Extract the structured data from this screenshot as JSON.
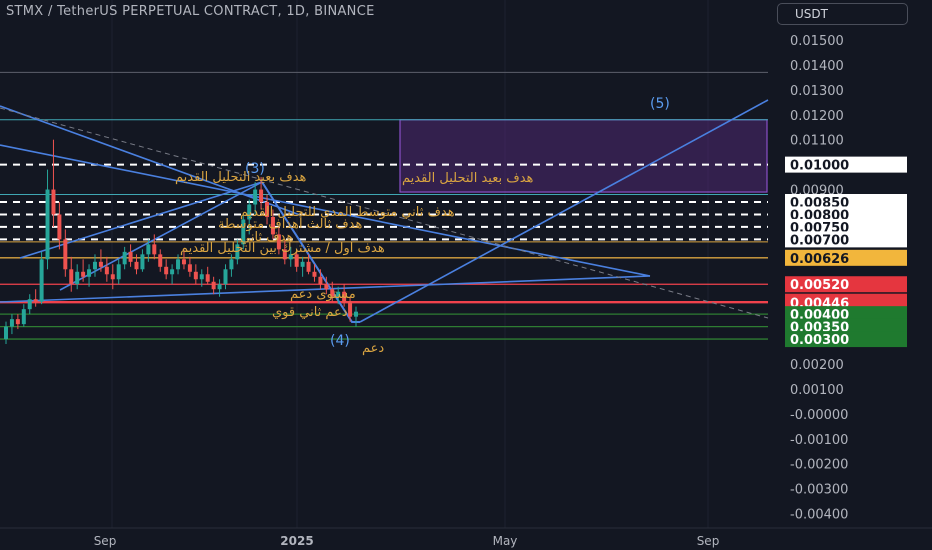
{
  "header": {
    "title": "STMX / TetherUS PERPETUAL CONTRACT, 1D, BINANCE",
    "currency": "USDT"
  },
  "colors": {
    "background": "#131722",
    "up": "#26a69a",
    "down": "#ef5350",
    "trendline": "#4a80e0",
    "annotation": "#d9a441",
    "zone": "#5b2d82"
  },
  "chart_data": {
    "type": "candlestick",
    "title": "STMX / TetherUS PERPETUAL CONTRACT, 1D, BINANCE",
    "y_axis_ticks": [
      "0.01500",
      "0.01400",
      "0.01300",
      "0.01200",
      "0.01100",
      "0.01000",
      "0.00900",
      "0.00200",
      "0.00100",
      "-0.00000",
      "-0.00100",
      "-0.00200",
      "-0.00300",
      "-0.00400"
    ],
    "ylim": [
      -0.0045,
      0.0158
    ],
    "x_axis_ticks": [
      "Sep",
      "2025",
      "May",
      "Sep"
    ],
    "price_tags": [
      {
        "value": "0.01000",
        "style": "white"
      },
      {
        "value": "0.00850",
        "style": "white"
      },
      {
        "value": "0.00800",
        "style": "white"
      },
      {
        "value": "0.00750",
        "style": "white"
      },
      {
        "value": "0.00700",
        "style": "white"
      },
      {
        "value": "0.00626",
        "style": "yellow"
      },
      {
        "value": "0.00520",
        "style": "red"
      },
      {
        "value": "0.00450",
        "style": "red"
      },
      {
        "value": "0.00446",
        "style": "red"
      },
      {
        "value": "0.00400",
        "style": "green"
      },
      {
        "value": "0.00350",
        "style": "green"
      },
      {
        "value": "0.00300",
        "style": "green"
      }
    ],
    "wave_labels": [
      "(3)",
      "(4)",
      "(5)"
    ],
    "annotations": [
      {
        "text": "هدف بعيد التحليل القديم"
      },
      {
        "text": "هدف ثاني متوسط المدى للتحليل القديم"
      },
      {
        "text": "هدف ثالث أهداف متوسطة"
      },
      {
        "text": "هدف ثاني"
      },
      {
        "text": "هدف اول / مشترك بين التحليل القديم"
      },
      {
        "text": "مستوى دعم"
      },
      {
        "text": "دعم ثاني قوي"
      },
      {
        "text": "دعم"
      }
    ],
    "target_zone": {
      "from": 0.0089,
      "to": 0.0118,
      "label": "هدف بعيد التحليل القديم"
    },
    "candles": [
      [
        0.003,
        0.0037,
        0.0028,
        0.0035
      ],
      [
        0.0035,
        0.004,
        0.0032,
        0.0038
      ],
      [
        0.0038,
        0.004,
        0.0034,
        0.0036
      ],
      [
        0.0036,
        0.0044,
        0.0035,
        0.0042
      ],
      [
        0.0042,
        0.0048,
        0.004,
        0.0046
      ],
      [
        0.0046,
        0.005,
        0.0043,
        0.0045
      ],
      [
        0.0045,
        0.0065,
        0.0044,
        0.0062
      ],
      [
        0.0062,
        0.0098,
        0.0058,
        0.009
      ],
      [
        0.009,
        0.011,
        0.0075,
        0.008
      ],
      [
        0.008,
        0.0085,
        0.0066,
        0.007
      ],
      [
        0.007,
        0.0074,
        0.0055,
        0.0058
      ],
      [
        0.0058,
        0.0063,
        0.0049,
        0.0052
      ],
      [
        0.0052,
        0.006,
        0.005,
        0.0057
      ],
      [
        0.0057,
        0.0062,
        0.0053,
        0.0055
      ],
      [
        0.0055,
        0.006,
        0.0051,
        0.0058
      ],
      [
        0.0058,
        0.0064,
        0.0055,
        0.0061
      ],
      [
        0.0061,
        0.0066,
        0.0057,
        0.0059
      ],
      [
        0.0059,
        0.0063,
        0.0053,
        0.0056
      ],
      [
        0.0056,
        0.006,
        0.005,
        0.0054
      ],
      [
        0.0054,
        0.0062,
        0.0052,
        0.006
      ],
      [
        0.006,
        0.0067,
        0.0058,
        0.0065
      ],
      [
        0.0065,
        0.0068,
        0.0059,
        0.0061
      ],
      [
        0.0061,
        0.0064,
        0.0056,
        0.0058
      ],
      [
        0.0058,
        0.0066,
        0.0057,
        0.0064
      ],
      [
        0.0064,
        0.007,
        0.0061,
        0.0068
      ],
      [
        0.0068,
        0.0072,
        0.0062,
        0.0064
      ],
      [
        0.0064,
        0.0066,
        0.0057,
        0.0059
      ],
      [
        0.0059,
        0.0062,
        0.0054,
        0.0056
      ],
      [
        0.0056,
        0.006,
        0.0052,
        0.0058
      ],
      [
        0.0058,
        0.0064,
        0.0056,
        0.0062
      ],
      [
        0.0062,
        0.0066,
        0.0058,
        0.006
      ],
      [
        0.006,
        0.0063,
        0.0055,
        0.0057
      ],
      [
        0.0057,
        0.006,
        0.0052,
        0.0054
      ],
      [
        0.0054,
        0.0058,
        0.0051,
        0.0056
      ],
      [
        0.0056,
        0.0059,
        0.0052,
        0.0053
      ],
      [
        0.0053,
        0.0055,
        0.0048,
        0.005
      ],
      [
        0.005,
        0.0054,
        0.0047,
        0.0052
      ],
      [
        0.0052,
        0.006,
        0.005,
        0.0058
      ],
      [
        0.0058,
        0.0064,
        0.0055,
        0.0062
      ],
      [
        0.0062,
        0.007,
        0.006,
        0.0068
      ],
      [
        0.0068,
        0.008,
        0.0066,
        0.0078
      ],
      [
        0.0078,
        0.0086,
        0.0072,
        0.0084
      ],
      [
        0.0084,
        0.0093,
        0.008,
        0.009
      ],
      [
        0.009,
        0.0095,
        0.0082,
        0.0085
      ],
      [
        0.0085,
        0.0088,
        0.0076,
        0.0079
      ],
      [
        0.0079,
        0.0082,
        0.007,
        0.0072
      ],
      [
        0.0072,
        0.0075,
        0.0064,
        0.0066
      ],
      [
        0.0066,
        0.007,
        0.006,
        0.0062
      ],
      [
        0.0062,
        0.0067,
        0.0059,
        0.0064
      ],
      [
        0.0064,
        0.0066,
        0.0057,
        0.0059
      ],
      [
        0.0059,
        0.0063,
        0.0055,
        0.0061
      ],
      [
        0.0061,
        0.0064,
        0.0056,
        0.0057
      ],
      [
        0.0057,
        0.006,
        0.0053,
        0.0055
      ],
      [
        0.0055,
        0.0058,
        0.005,
        0.0052
      ],
      [
        0.0052,
        0.0055,
        0.0048,
        0.005
      ],
      [
        0.005,
        0.0053,
        0.0045,
        0.0047
      ],
      [
        0.0047,
        0.0051,
        0.0044,
        0.0049
      ],
      [
        0.0049,
        0.0052,
        0.0043,
        0.0045
      ],
      [
        0.0045,
        0.0047,
        0.0037,
        0.0039
      ],
      [
        0.0039,
        0.0043,
        0.0035,
        0.0041
      ]
    ]
  }
}
